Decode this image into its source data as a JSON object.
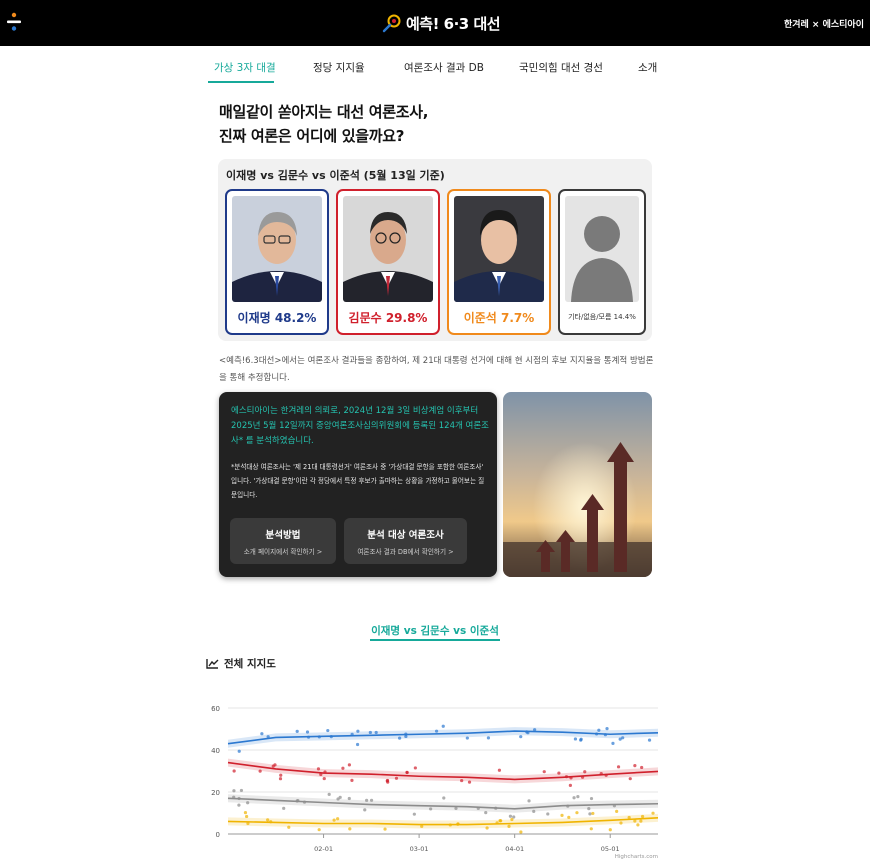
{
  "header": {
    "brand": "예측! 6·3 대선",
    "partner": "한겨레 × 에스티아이",
    "colors": {
      "bar": "#000000",
      "accent": "#16a99a"
    }
  },
  "nav": {
    "items": [
      {
        "label": "가상 3자 대결",
        "active": true
      },
      {
        "label": "정당 지지율"
      },
      {
        "label": "여론조사 결과 DB"
      },
      {
        "label": "국민의힘 대선 경선"
      },
      {
        "label": "소개"
      }
    ]
  },
  "headline": {
    "line1": "매일같이 쏟아지는 대선 여론조사,",
    "line2": "진짜 여론은 어디에 있을까요?"
  },
  "matchup": {
    "title": "이재명 vs 김문수 vs 이준석 (5월 13일 기준)",
    "cards": [
      {
        "name_pct": "이재명 48.2%",
        "color": "#1f3a8a",
        "icon": "person-photo"
      },
      {
        "name_pct": "김문수 29.8%",
        "color": "#d0202c",
        "icon": "person-photo"
      },
      {
        "name_pct": "이준석 7.7%",
        "color": "#f08a1c",
        "icon": "person-photo"
      },
      {
        "name_pct": "기타/없음/모름 14.4%",
        "color": "#3a3a3a",
        "icon": "silhouette-icon"
      }
    ]
  },
  "description": "<예측!6.3대선>에서는 여론조사 결과들을 종합하여, 제 21대 대통령 선거에 대해 현 시점의 후보 지지율을 통계적 방법론을 통해 추정합니다.",
  "info": {
    "lead": "에스티아이는 한겨레의 의뢰로, 2024년 12월 3일 비상계엄 이후부터 2025년 5월 12일까지 중앙여론조사심의위원회에 등록된 124개 여론조사* 를 분석하였습니다.",
    "note": "*분석대상 여론조사는 '제 21대 대통령선거' 여론조사 중 '가상대결 문항을 포함한 여론조사' 입니다. '가상대결 문항'이란 각 정당에서 특정 후보가 출마하는 상황을 가정하고 물어보는 질문입니다.",
    "buttons": [
      {
        "title": "분석방법",
        "sub": "소개 페이지에서 확인하기 >"
      },
      {
        "title": "분석 대상 여론조사",
        "sub": "여론조사 결과 DB에서 확인하기 >"
      }
    ]
  },
  "section": {
    "tab": "이재명 vs 김문수 vs 이준석",
    "chart_title": "전체 지지도",
    "credit": "Highcharts.com"
  },
  "chart_data": {
    "type": "line",
    "title": "전체 지지도",
    "xlabel": "",
    "ylabel": "",
    "ylim": [
      0,
      60
    ],
    "yticks": [
      "0",
      "20",
      "40",
      "60"
    ],
    "x_tick_labels": [
      "02-01",
      "03-01",
      "04-01",
      "05-01"
    ],
    "x": [
      "01-01",
      "01-15",
      "02-01",
      "02-15",
      "03-01",
      "03-15",
      "04-01",
      "04-15",
      "05-01",
      "05-13"
    ],
    "grid": true,
    "legend": "none",
    "series": [
      {
        "color": "#2b78d0",
        "values": [
          43,
          46,
          46.5,
          47,
          47.5,
          48,
          49,
          48.5,
          47.5,
          48.2
        ]
      },
      {
        "color": "#d0202c",
        "values": [
          34,
          31,
          29,
          28.5,
          27.5,
          27,
          26,
          27,
          28.5,
          29.8
        ]
      },
      {
        "color": "#8c8c8c",
        "values": [
          17,
          16,
          15,
          14,
          13.5,
          13,
          12,
          13.5,
          14,
          14.4
        ]
      },
      {
        "color": "#f0b400",
        "values": [
          6,
          5.5,
          5,
          5,
          4.5,
          4.5,
          5,
          5.5,
          6.5,
          7.7
        ]
      }
    ]
  }
}
